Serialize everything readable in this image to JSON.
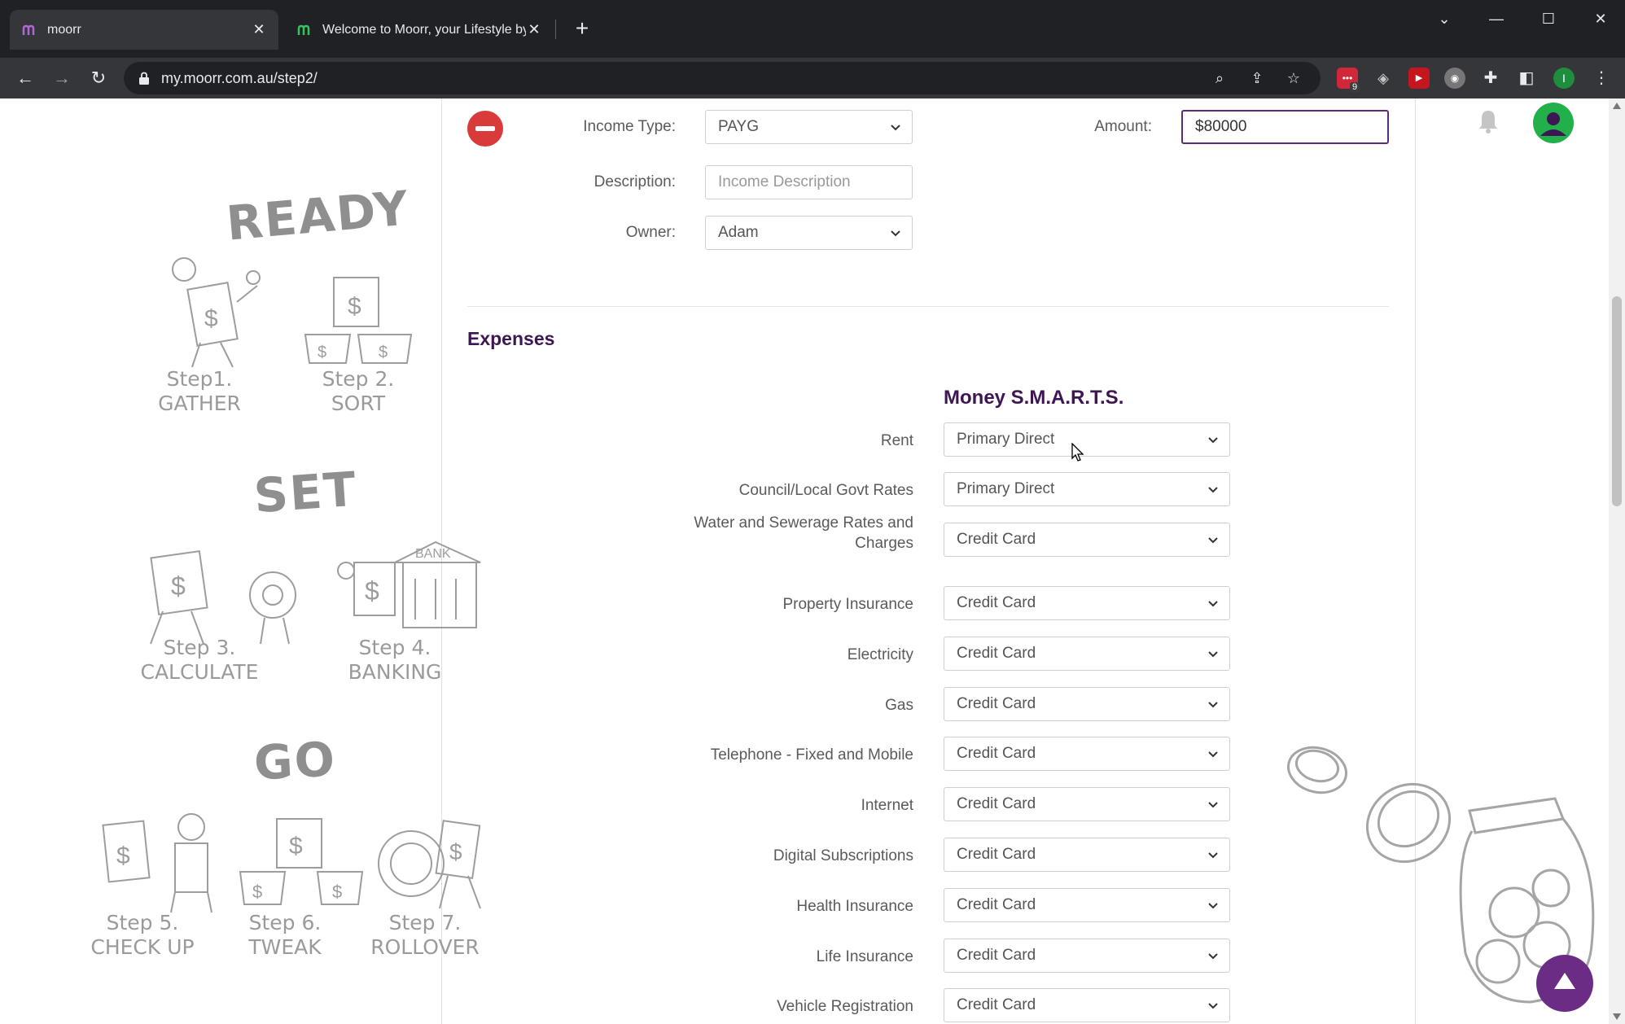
{
  "browser": {
    "tabs": [
      {
        "title": "moorr",
        "active": true
      },
      {
        "title": "Welcome to Moorr, your Lifestyle by",
        "active": false
      }
    ],
    "url": "my.moorr.com.au/step2/",
    "profile_initial": "I",
    "extension_badge": "9"
  },
  "income": {
    "type_label": "Income Type:",
    "type_value": "PAYG",
    "amount_label": "Amount:",
    "amount_value": "$80000",
    "description_label": "Description:",
    "description_placeholder": "Income Description",
    "owner_label": "Owner:",
    "owner_value": "Adam"
  },
  "expenses": {
    "section_title": "Expenses",
    "column_title": "Money S.M.A.R.T.S.",
    "rows": [
      {
        "label": "Rent",
        "value": "Primary Direct"
      },
      {
        "label": "Council/Local Govt Rates",
        "value": "Primary Direct"
      },
      {
        "label": "Water and Sewerage Rates and Charges",
        "value": "Credit Card"
      },
      {
        "label": "Property Insurance",
        "value": "Credit Card"
      },
      {
        "label": "Electricity",
        "value": "Credit Card"
      },
      {
        "label": "Gas",
        "value": "Credit Card"
      },
      {
        "label": "Telephone - Fixed and Mobile",
        "value": "Credit Card"
      },
      {
        "label": "Internet",
        "value": "Credit Card"
      },
      {
        "label": "Digital Subscriptions",
        "value": "Credit Card"
      },
      {
        "label": "Health Insurance",
        "value": "Credit Card"
      },
      {
        "label": "Life Insurance",
        "value": "Credit Card"
      },
      {
        "label": "Vehicle Registration",
        "value": "Credit Card"
      }
    ]
  },
  "sidebar": {
    "ready": "READY",
    "set": "SET",
    "go": "GO",
    "steps": [
      {
        "line1": "Step1.",
        "line2": "GATHER"
      },
      {
        "line1": "Step 2.",
        "line2": "SORT"
      },
      {
        "line1": "Step 3.",
        "line2": "CALCULATE"
      },
      {
        "line1": "Step 4.",
        "line2": "BANKING"
      },
      {
        "line1": "Step 5.",
        "line2": "CHECK UP"
      },
      {
        "line1": "Step 6.",
        "line2": "TWEAK"
      },
      {
        "line1": "Step 7.",
        "line2": "ROLLOVER"
      }
    ],
    "bank_sign": "BANK"
  },
  "colors": {
    "brand_purple": "#3e1653",
    "accent_purple": "#6b2c86",
    "remove_red": "#d93a3a",
    "avatar_green": "#22b04b"
  }
}
